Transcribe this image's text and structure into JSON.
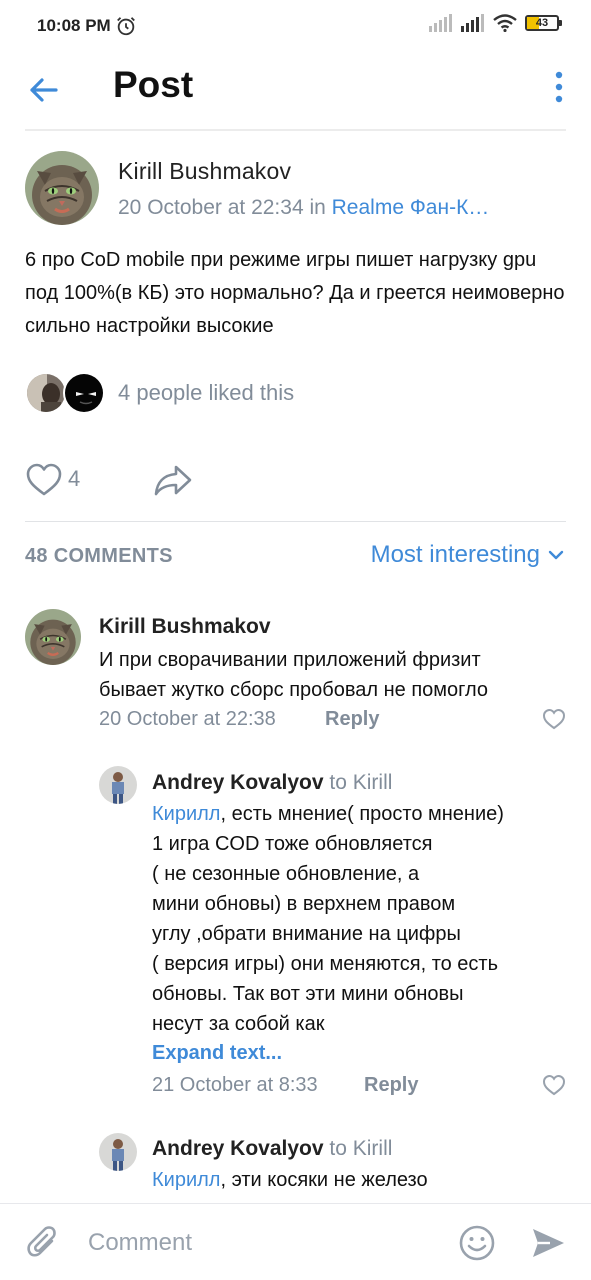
{
  "status_bar": {
    "time": "10:08 PM",
    "battery": "43",
    "icons": [
      "alarm-icon",
      "signal-icon",
      "signal-icon",
      "wifi-icon",
      "battery-icon"
    ]
  },
  "header": {
    "title": "Post",
    "back_icon": "arrow-left-icon",
    "more_icon": "more-vertical-icon"
  },
  "post": {
    "author": "Kirill Bushmakov",
    "date": "20 October at 22:34 in ",
    "group": "Realme Фан-К…",
    "text": "6 про CoD mobile при режиме игры пишет нагрузку gpu под 100%(в КБ) это нормально? Да и греется неимоверно сильно настройки высокие",
    "liked_text": "4 people liked this",
    "like_count": "4"
  },
  "comments_header": {
    "count_label": "48 COMMENTS",
    "sort_label": "Most interesting"
  },
  "comments": [
    {
      "author": "Kirill Bushmakov",
      "reply_to": "",
      "link": "",
      "lines": [
        "И при сворачивании приложений фризит",
        "бывает жутко сборс пробовал не помогло"
      ],
      "expand": "",
      "date": "20 October at 22:38",
      "reply": "Reply"
    },
    {
      "author": "Andrey Kovalyov",
      "reply_to": "to Kirill",
      "link": "Кирилл",
      "lines": [
        ", есть мнение( просто мнение)",
        "1 игра COD тоже обновляется",
        "( не сезонные обновление, а",
        "мини обновы) в верхнем правом",
        "углу ,обрати внимание на цифры",
        "( версия игры) они меняются, то есть",
        "обновы. Так вот эти мини обновы",
        "несут за собой как"
      ],
      "expand": "Expand text...",
      "date": "21 October at 8:33",
      "reply": "Reply"
    },
    {
      "author": "Andrey Kovalyov",
      "reply_to": "to Kirill",
      "link": "Кирилл",
      "lines": [
        ", эти косяки не железо"
      ],
      "expand": "",
      "date": "",
      "reply": ""
    }
  ],
  "composer": {
    "placeholder": "Comment",
    "attach_icon": "paperclip-icon",
    "emoji_icon": "smile-icon",
    "send_icon": "send-icon"
  },
  "colors": {
    "accent": "#3f8ad8",
    "secondary_text": "#818c99",
    "divider": "#e1e3e6"
  }
}
